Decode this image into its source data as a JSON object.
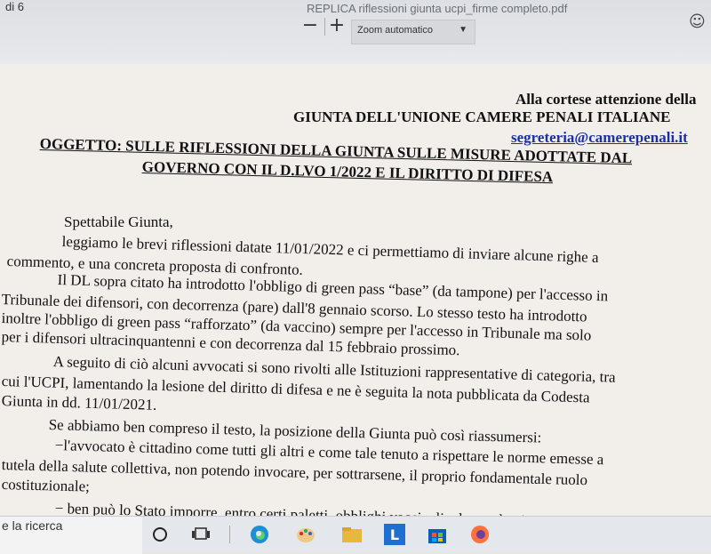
{
  "toolbar": {
    "page_info": "di 6",
    "file_name": "REPLICA riflessioni giunta ucpi_firme completo.pdf",
    "zoom_out": "−",
    "zoom_in": "+",
    "zoom_value": "Zoom automatico"
  },
  "letter": {
    "header1": "Alla cortese attenzione della",
    "header2": "GIUNTA DELL'UNIONE CAMERE PENALI ITALIANE",
    "email": "segreteria@camerepenali.it",
    "subject1": "OGGETTO: SULLE RIFLESSIONI DELLA GIUNTA SULLE MISURE ADOTTATE DAL",
    "subject2": "GOVERNO CON IL D.LVO 1/2022 E IL DIRITTO DI DIFESA",
    "greeting": "Spettabile Giunta,",
    "body_lines": [
      "leggiamo le brevi riflessioni datate 11/01/2022 e ci permettiamo di inviare alcune righe a",
      "commento, e una concreta proposta di confronto.",
      "Il DL sopra citato ha introdotto l'obbligo di green pass “base” (da tampone) per l'accesso in",
      "Tribunale dei difensori, con decorrenza (pare) dall'8 gennaio scorso. Lo stesso testo ha introdotto",
      "inoltre l'obbligo di green pass “rafforzato” (da vaccino) sempre per l'accesso in Tribunale ma solo",
      "per i difensori ultracinquantenni e con decorrenza dal 15 febbraio prossimo.",
      "A seguito di ciò alcuni avvocati si sono rivolti alle Istituzioni rappresentative di categoria, tra",
      "cui l'UCPI, lamentando la lesione del diritto di difesa e ne è seguita la nota pubblicata da Codesta",
      "Giunta in dd. 11/01/2021.",
      "Se abbiamo ben compreso il testo, la posizione della Giunta può così riassumersi:",
      "−l'avvocato è cittadino come tutti gli altri e come tale tenuto a rispettare le norme emesse a",
      "tutela della salute collettiva, non potendo invocare, per sottrarsene, il proprio fondamentale ruolo",
      "costituzionale;",
      "− ben può lo Stato imporre, entro certi paletti, obblighi vaccinali e la pandemia non ha"
    ]
  },
  "taskbar": {
    "search_text": "e la ricerca",
    "icons": [
      "search-circle-icon",
      "task-view-icon",
      "edge-icon",
      "paint-icon",
      "file-explorer-icon",
      "l-app-icon",
      "store-icon",
      "firefox-icon"
    ]
  }
}
